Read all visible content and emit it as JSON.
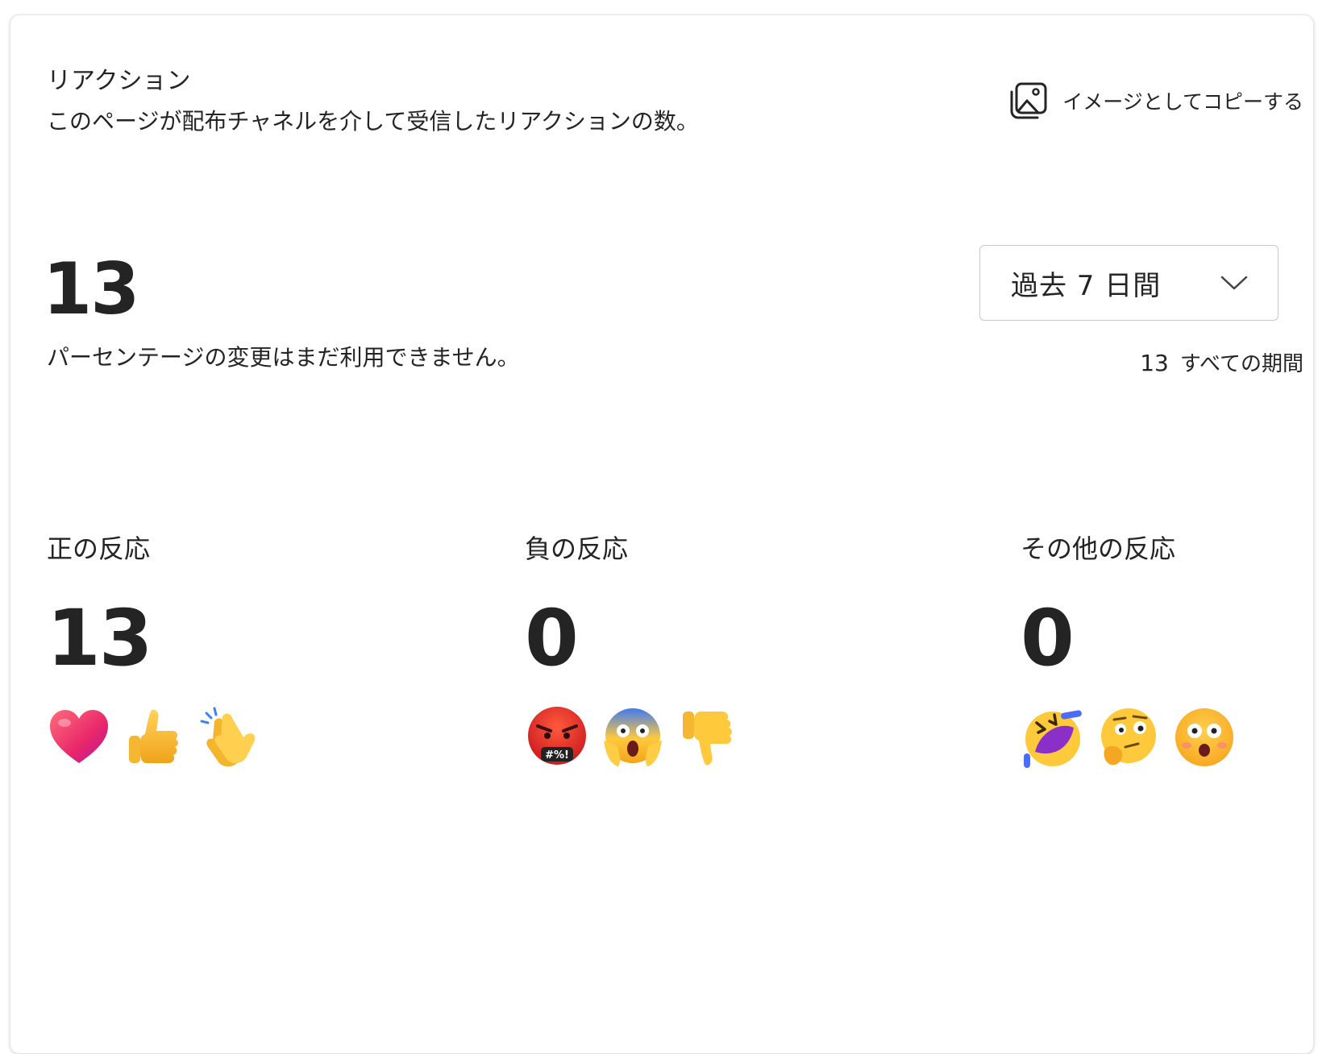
{
  "header": {
    "title": "リアクション",
    "subtitle": "このページが配布チャネルを介して受信したリアクションの数。",
    "copy_label": "イメージとしてコピーする",
    "copy_icon": "image-copy-icon"
  },
  "summary": {
    "total": "13",
    "note": "パーセンテージの変更はまだ利用できません。",
    "period_select": {
      "value": "過去 7 日間",
      "icon": "chevron-down-icon"
    },
    "all_time": {
      "count": "13",
      "label": "すべての期間"
    }
  },
  "categories": [
    {
      "title": "正の反応",
      "count": "13",
      "emojis": [
        "heart-emoji",
        "thumbs-up-emoji",
        "clapping-hands-emoji"
      ]
    },
    {
      "title": "負の反応",
      "count": "0",
      "emojis": [
        "angry-face-emoji",
        "screaming-face-emoji",
        "thumbs-down-emoji"
      ]
    },
    {
      "title": "その他の反応",
      "count": "0",
      "emojis": [
        "rolling-laughing-emoji",
        "thinking-face-emoji",
        "surprised-face-emoji"
      ]
    }
  ]
}
